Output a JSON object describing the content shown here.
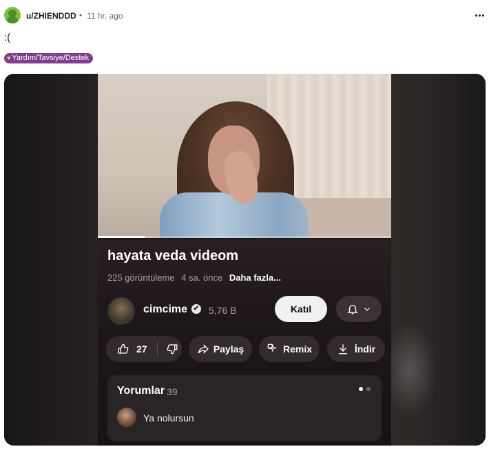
{
  "post": {
    "username": "u/ZHIENDDD",
    "separator": "•",
    "time": "11 hr. ago",
    "title": ":(",
    "flair": "Yardım/Tavsiye/Destek",
    "flair_icon": "heart-hands-icon",
    "menu_icon": "more-horizontal-icon"
  },
  "video": {
    "progress_fraction": 0.16,
    "title": "hayata veda videom",
    "views": "225 görüntüleme",
    "time_ago": "4 sa. önce",
    "more_label": "Daha fazla...",
    "channel": {
      "name": "cimcime",
      "verified_icon": "verified-check-icon",
      "subscribers": "5,76 B",
      "join_label": "Katıl",
      "bell_icon": "bell-icon"
    },
    "actions": {
      "like_count": "27",
      "share_label": "Paylaş",
      "remix_label": "Remix",
      "download_label": "İndir"
    },
    "comments": {
      "title": "Yorumlar",
      "count": "39",
      "first_comment": "Ya nolursun"
    }
  },
  "colors": {
    "flair_bg": "#7e3f8f",
    "avatar_green": "#7bc142",
    "panel_bg": "#1d1719",
    "pill_bg": "#342b2d"
  }
}
